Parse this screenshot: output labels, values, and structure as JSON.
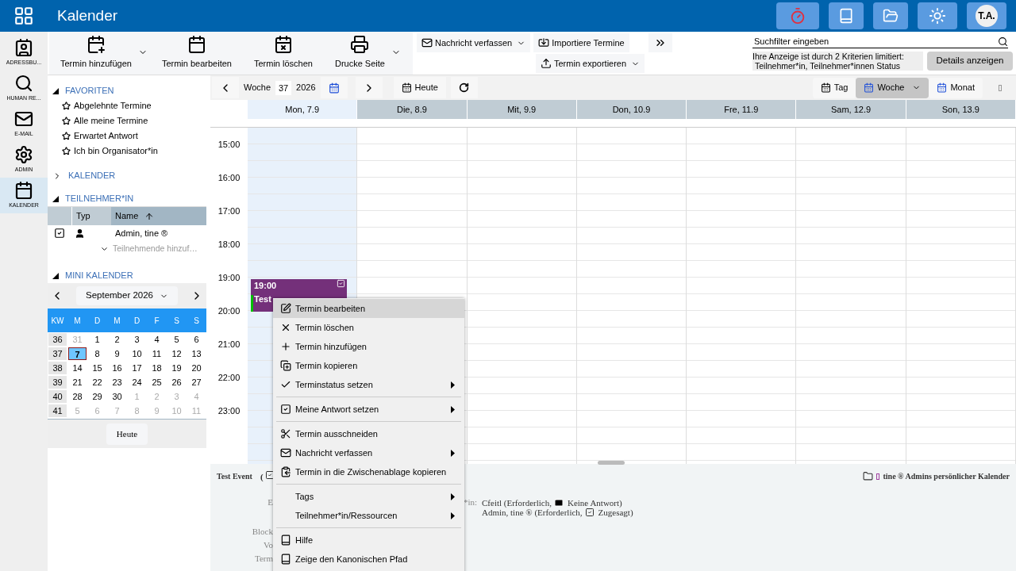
{
  "header": {
    "title": "Kalender",
    "user_initials": "T.A."
  },
  "rail": [
    {
      "label": "ADRESSBU...",
      "selected": false
    },
    {
      "label": "HUMAN RE...",
      "selected": false
    },
    {
      "label": "E-MAIL",
      "selected": false
    },
    {
      "label": "ADMIN",
      "selected": false
    },
    {
      "label": "KALENDER",
      "selected": true
    }
  ],
  "toolbar": {
    "large_buttons": [
      {
        "label": "Termin hinzufügen",
        "dropdown": true
      },
      {
        "label": "Termin bearbeiten",
        "dropdown": false
      },
      {
        "label": "Termin löschen",
        "dropdown": false
      },
      {
        "label": "Drucke Seite",
        "dropdown": true
      }
    ],
    "small_buttons": [
      {
        "label": "Nachricht verfassen",
        "dropdown": true
      },
      {
        "label": "Importiere Termine",
        "dropdown": false
      },
      {
        "label": "Termin exportieren",
        "dropdown": true
      }
    ],
    "search": {
      "placeholder": "Suchfilter eingeben"
    },
    "filter_notice": [
      "Ihre Anzeige ist durch 2 Kriterien limitiert:",
      "Teilnehmer*in, Teilnehmer*innen Status"
    ],
    "details_button": "Details anzeigen"
  },
  "sidebar": {
    "favorites": {
      "title": "FAVORITEN",
      "expanded": true,
      "items": [
        "Abgelehnte Termine",
        "Alle meine Termine",
        "Erwartet Antwort",
        "Ich bin Organisator*in"
      ]
    },
    "calendars": {
      "title": "KALENDER",
      "expanded": false
    },
    "participants": {
      "title": "TEILNEHMER*IN",
      "expanded": true,
      "columns": [
        "Typ",
        "Name"
      ],
      "rows": [
        {
          "name": "Admin, tine ®",
          "checked": true
        }
      ],
      "add_placeholder": "Teilnehmende hinzuf…"
    },
    "mini_calendar": {
      "title": "MINI KALENDER",
      "expanded": true,
      "month": "September 2026",
      "weekdays": [
        "KW",
        "M",
        "D",
        "M",
        "D",
        "F",
        "S",
        "S"
      ],
      "weeks": [
        {
          "kw": "36",
          "days": [
            {
              "d": "31",
              "other": true,
              "selected": false
            },
            {
              "d": "1",
              "other": false,
              "selected": false
            },
            {
              "d": "2",
              "other": false,
              "selected": false
            },
            {
              "d": "3",
              "other": false,
              "selected": false
            },
            {
              "d": "4",
              "other": false,
              "selected": false
            },
            {
              "d": "5",
              "other": false,
              "selected": false
            },
            {
              "d": "6",
              "other": false,
              "selected": false
            }
          ]
        },
        {
          "kw": "37",
          "days": [
            {
              "d": "7",
              "other": false,
              "selected": true
            },
            {
              "d": "8",
              "other": false,
              "selected": false
            },
            {
              "d": "9",
              "other": false,
              "selected": false
            },
            {
              "d": "10",
              "other": false,
              "selected": false
            },
            {
              "d": "11",
              "other": false,
              "selected": false
            },
            {
              "d": "12",
              "other": false,
              "selected": false
            },
            {
              "d": "13",
              "other": false,
              "selected": false
            }
          ]
        },
        {
          "kw": "38",
          "days": [
            {
              "d": "14",
              "other": false,
              "selected": false
            },
            {
              "d": "15",
              "other": false,
              "selected": false
            },
            {
              "d": "16",
              "other": false,
              "selected": false
            },
            {
              "d": "17",
              "other": false,
              "selected": false
            },
            {
              "d": "18",
              "other": false,
              "selected": false
            },
            {
              "d": "19",
              "other": false,
              "selected": false
            },
            {
              "d": "20",
              "other": false,
              "selected": false
            }
          ]
        },
        {
          "kw": "39",
          "days": [
            {
              "d": "21",
              "other": false,
              "selected": false
            },
            {
              "d": "22",
              "other": false,
              "selected": false
            },
            {
              "d": "23",
              "other": false,
              "selected": false
            },
            {
              "d": "24",
              "other": false,
              "selected": false
            },
            {
              "d": "25",
              "other": false,
              "selected": false
            },
            {
              "d": "26",
              "other": false,
              "selected": false
            },
            {
              "d": "27",
              "other": false,
              "selected": false
            }
          ]
        },
        {
          "kw": "40",
          "days": [
            {
              "d": "28",
              "other": false,
              "selected": false
            },
            {
              "d": "29",
              "other": false,
              "selected": false
            },
            {
              "d": "30",
              "other": false,
              "selected": false
            },
            {
              "d": "1",
              "other": true,
              "selected": false
            },
            {
              "d": "2",
              "other": true,
              "selected": false
            },
            {
              "d": "3",
              "other": true,
              "selected": false
            },
            {
              "d": "4",
              "other": true,
              "selected": false
            }
          ]
        },
        {
          "kw": "41",
          "days": [
            {
              "d": "5",
              "other": true,
              "selected": false
            },
            {
              "d": "6",
              "other": true,
              "selected": false
            },
            {
              "d": "7",
              "other": true,
              "selected": false
            },
            {
              "d": "8",
              "other": true,
              "selected": false
            },
            {
              "d": "9",
              "other": true,
              "selected": false
            },
            {
              "d": "10",
              "other": true,
              "selected": false
            },
            {
              "d": "11",
              "other": true,
              "selected": false
            }
          ]
        }
      ],
      "today_button": "Heute"
    }
  },
  "calendar": {
    "nav": {
      "week_label": "Woche",
      "week": "37",
      "year": "2026",
      "today": "Heute"
    },
    "views": [
      {
        "label": "Tag",
        "selected": false
      },
      {
        "label": "Woche",
        "selected": true
      },
      {
        "label": "Monat",
        "selected": false
      }
    ],
    "days": [
      {
        "label": "Mon, 7.9",
        "selected": true
      },
      {
        "label": "Die, 8.9",
        "selected": false
      },
      {
        "label": "Mit, 9.9",
        "selected": false
      },
      {
        "label": "Don, 10.9",
        "selected": false
      },
      {
        "label": "Fre, 11.9",
        "selected": false
      },
      {
        "label": "Sam, 12.9",
        "selected": false
      },
      {
        "label": "Son, 13.9",
        "selected": false
      }
    ],
    "hours": [
      "15:00",
      "16:00",
      "17:00",
      "18:00",
      "19:00",
      "20:00",
      "21:00",
      "22:00",
      "23:00"
    ],
    "event": {
      "time": "19:00",
      "title": "Test",
      "color": "#74307a"
    }
  },
  "context_menu": [
    [
      {
        "label": "Termin bearbeiten",
        "highlighted": true,
        "submenu": false
      },
      {
        "label": "Termin löschen",
        "highlighted": false,
        "submenu": false
      },
      {
        "label": "Termin hinzufügen",
        "highlighted": false,
        "submenu": false
      },
      {
        "label": "Termin kopieren",
        "highlighted": false,
        "submenu": false
      },
      {
        "label": "Terminstatus setzen",
        "highlighted": false,
        "submenu": true
      }
    ],
    [
      {
        "label": "Meine Antwort setzen",
        "highlighted": false,
        "submenu": true
      }
    ],
    [
      {
        "label": "Termin ausschneiden",
        "highlighted": false,
        "submenu": false
      },
      {
        "label": "Nachricht verfassen",
        "highlighted": false,
        "submenu": true
      },
      {
        "label": "Termin in die Zwischenablage kopieren",
        "highlighted": false,
        "submenu": false
      }
    ],
    [
      {
        "label": "Tags",
        "highlighted": false,
        "submenu": true
      },
      {
        "label": "Teilnehmer*in/Ressourcen",
        "highlighted": false,
        "submenu": true
      }
    ],
    [
      {
        "label": "Hilfe",
        "highlighted": false,
        "submenu": false
      },
      {
        "label": "Zeige den Kanonischen Pfad",
        "highlighted": false,
        "submenu": false
      }
    ]
  ],
  "details": {
    "title": "Test Event",
    "paren": "(",
    "labels": [
      "E",
      "Block",
      "Vo",
      "Term"
    ],
    "participants_label": "*in:",
    "participants": [
      {
        "text": "Cfeitl (Erforderlich,",
        "status": "Keine Antwort)",
        "kind": "mail"
      },
      {
        "text": "Admin, tine ® (Erforderlich,",
        "status": "Zugesagt)",
        "kind": "check"
      }
    ],
    "calendar_name": "tine ® Admins persönlicher Kalender"
  }
}
